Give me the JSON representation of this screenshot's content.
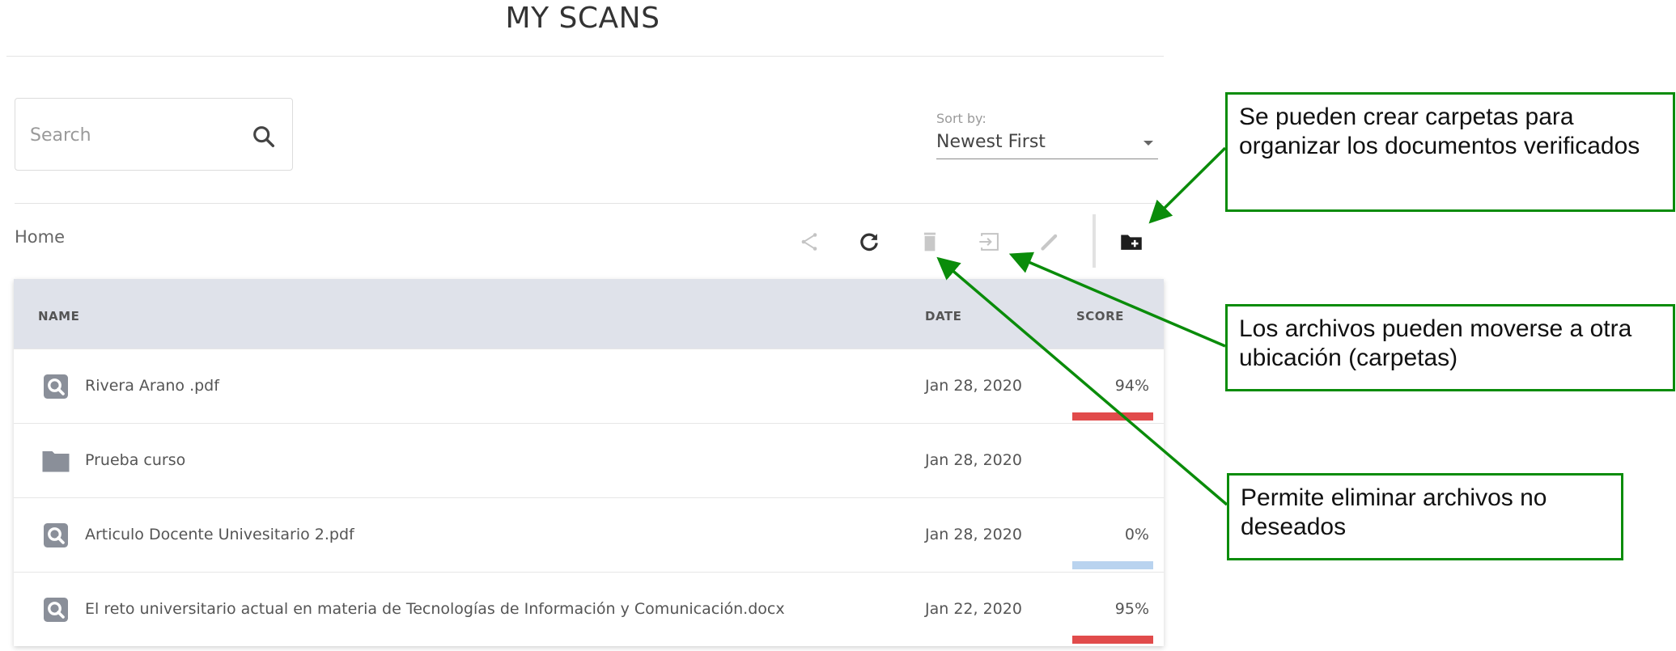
{
  "page_title": "MY SCANS",
  "search": {
    "placeholder": "Search",
    "value": ""
  },
  "sort": {
    "label": "Sort by:",
    "selected": "Newest First"
  },
  "breadcrumb": "Home",
  "toolbar": {
    "icons": [
      "share-icon",
      "refresh-icon",
      "trash-icon",
      "move-icon",
      "edit-icon",
      "new-folder-icon"
    ]
  },
  "table": {
    "columns": {
      "name": "NAME",
      "date": "DATE",
      "score": "SCORE"
    },
    "rows": [
      {
        "type": "scan",
        "name": "Rivera Arano .pdf",
        "date": "Jan 28, 2020",
        "score": "94%",
        "score_color": "#e14b4b"
      },
      {
        "type": "folder",
        "name": "Prueba curso",
        "date": "Jan 28, 2020",
        "score": "",
        "score_color": ""
      },
      {
        "type": "scan",
        "name": "Articulo Docente Univesitario 2.pdf",
        "date": "Jan 28, 2020",
        "score": "0%",
        "score_color": "#b9d3ef"
      },
      {
        "type": "scan",
        "name": "El reto universitario actual en materia de Tecnologías de Información y Comunicación.docx",
        "date": "Jan 22, 2020",
        "score": "95%",
        "score_color": "#e14b4b"
      }
    ]
  },
  "callouts": {
    "new_folder": "Se pueden crear carpetas para organizar los documentos verificados",
    "move": "Los archivos pueden moverse a otra ubicación (carpetas)",
    "delete": "Permite eliminar archivos no deseados"
  },
  "colors": {
    "accent_green": "#0a8c0a",
    "header_bg": "#dfe2ea",
    "icon_gray": "#8a8f99",
    "score_high": "#e14b4b",
    "score_low": "#b9d3ef"
  }
}
